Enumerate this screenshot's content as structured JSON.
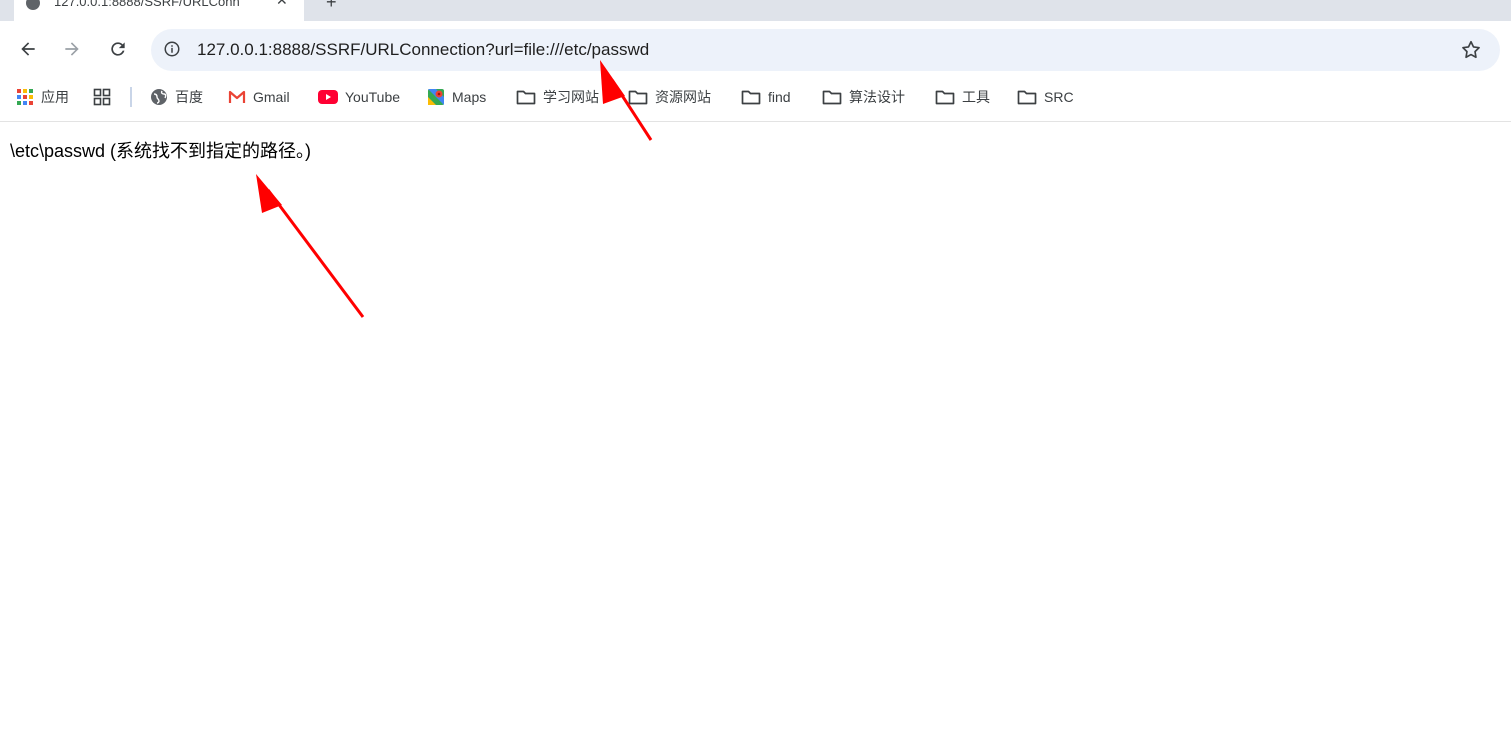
{
  "tab": {
    "title": "127.0.0.1:8888/SSRF/URLConn",
    "close_glyph": "✕",
    "new_tab_glyph": "+"
  },
  "toolbar": {
    "url": "127.0.0.1:8888/SSRF/URLConnection?url=file:///etc/passwd"
  },
  "bookmarks": {
    "items": [
      {
        "label": "应用",
        "icon": "apps-grid-icon"
      },
      {
        "label": "",
        "icon": "tab-groups-icon"
      },
      {
        "label": "百度",
        "icon": "globe-icon"
      },
      {
        "label": "Gmail",
        "icon": "gmail-icon"
      },
      {
        "label": "YouTube",
        "icon": "youtube-icon"
      },
      {
        "label": "Maps",
        "icon": "maps-icon"
      },
      {
        "label": "学习网站",
        "icon": "folder-icon"
      },
      {
        "label": "资源网站",
        "icon": "folder-icon"
      },
      {
        "label": "find",
        "icon": "folder-icon"
      },
      {
        "label": "算法设计",
        "icon": "folder-icon"
      },
      {
        "label": "工具",
        "icon": "folder-icon"
      },
      {
        "label": "SRC",
        "icon": "folder-icon"
      }
    ]
  },
  "content": {
    "message": "\\etc\\passwd (系统找不到指定的路径。)"
  },
  "colors": {
    "annotation_arrow": "#ff0000",
    "tabstrip_bg": "#dfe3ea",
    "omnibox_bg": "#edf2fa"
  }
}
